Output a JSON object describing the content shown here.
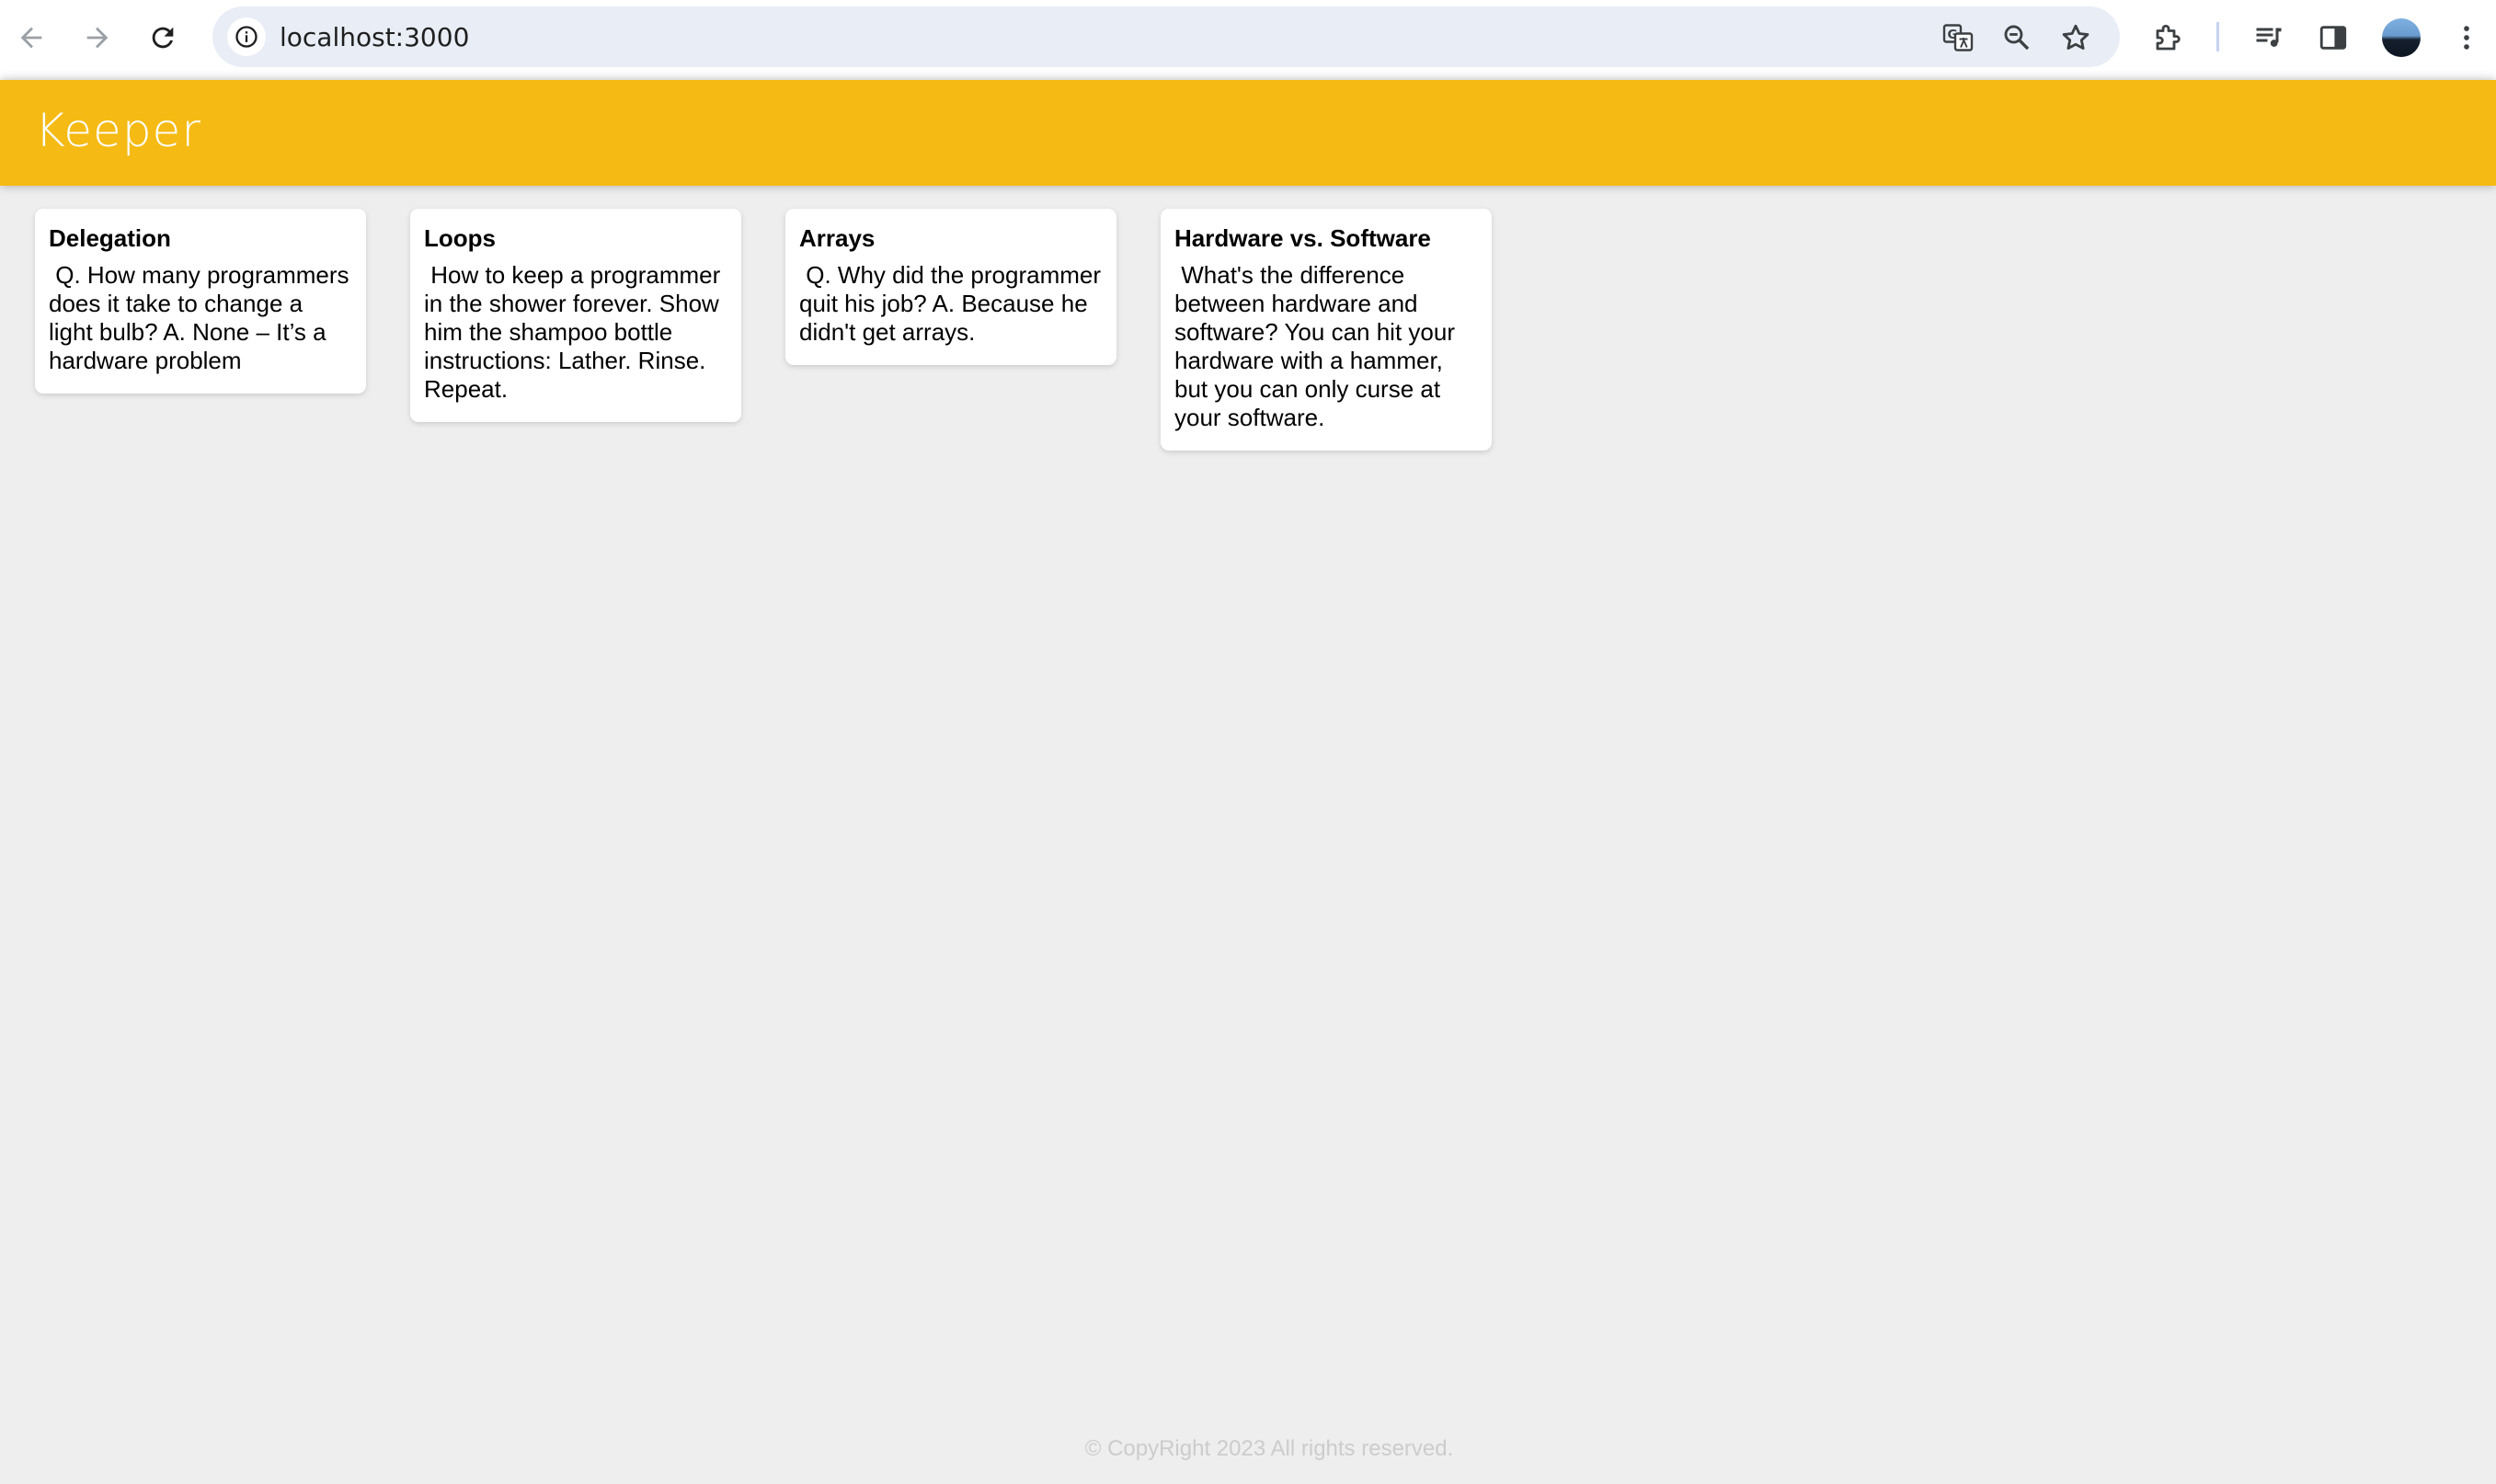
{
  "browser": {
    "url": "localhost:3000",
    "icons": {
      "back": "back-arrow-icon",
      "forward": "forward-arrow-icon",
      "reload": "reload-icon",
      "site_info": "info-icon",
      "translate": "translate-icon",
      "zoom": "zoom-out-icon",
      "bookmark": "star-icon",
      "extensions": "puzzle-icon",
      "media": "media-queue-icon",
      "side_panel": "side-panel-icon",
      "profile": "avatar",
      "menu": "kebab-menu-icon"
    }
  },
  "app": {
    "title": "Keeper",
    "header_color": "#f5ba13"
  },
  "notes": [
    {
      "title": "Delegation",
      "content": " Q. How many programmers does it take to change a light bulb? A. None – It’s a hardware problem"
    },
    {
      "title": "Loops",
      "content": " How to keep a programmer in the shower forever. Show him the shampoo bottle instructions: Lather. Rinse. Repeat."
    },
    {
      "title": "Arrays",
      "content": " Q. Why did the programmer quit his job? A. Because he didn't get arrays."
    },
    {
      "title": "Hardware vs. Software",
      "content": " What's the difference between hardware and software? You can hit your hardware with a hammer, but you can only curse at your software."
    }
  ],
  "footer": {
    "text": "© CopyRight 2023 All rights reserved."
  }
}
